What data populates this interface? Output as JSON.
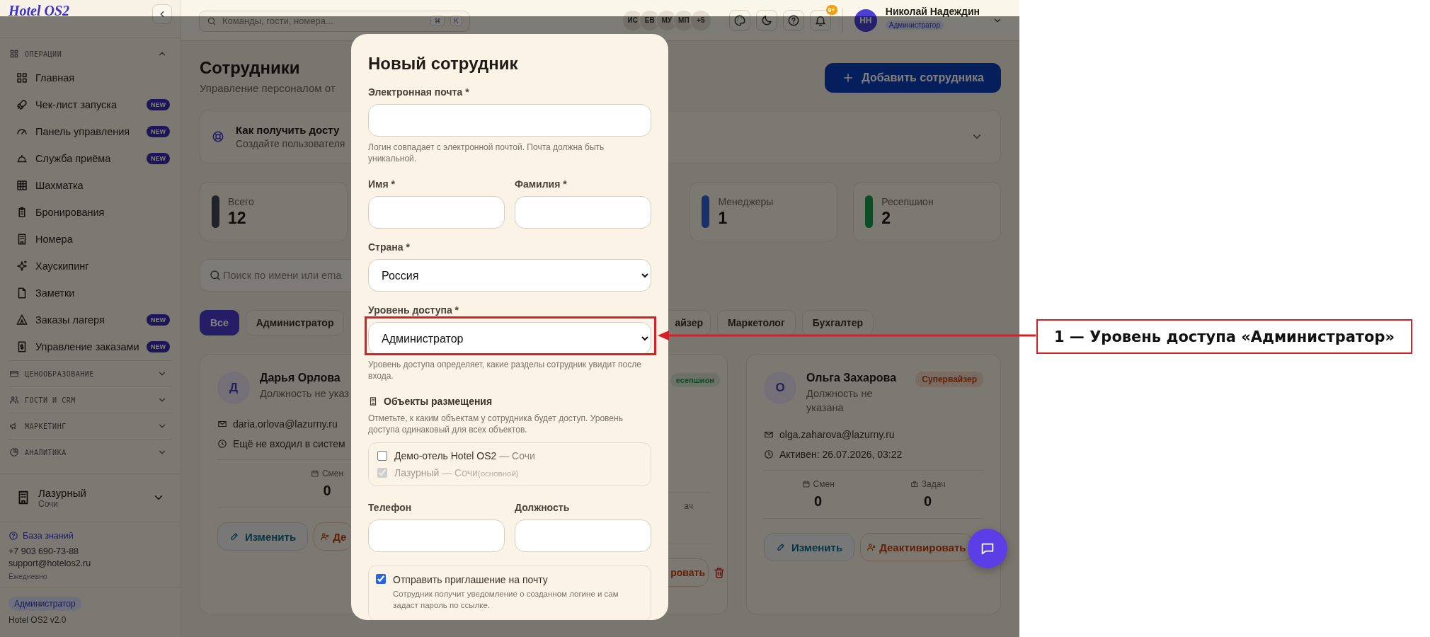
{
  "sidebar": {
    "logo": "Hotel OS2",
    "sections": [
      {
        "title": "ОПЕРАЦИИ",
        "expanded": true,
        "items": [
          {
            "label": "Главная"
          },
          {
            "label": "Чек-лист запуска",
            "badge": "NEW"
          },
          {
            "label": "Панель управления",
            "badge": "NEW"
          },
          {
            "label": "Служба приёма",
            "badge": "NEW"
          },
          {
            "label": "Шахматка"
          },
          {
            "label": "Бронирования"
          },
          {
            "label": "Номера"
          },
          {
            "label": "Хаускипинг"
          },
          {
            "label": "Заметки"
          },
          {
            "label": "Заказы лагеря",
            "badge": "NEW"
          },
          {
            "label": "Управление заказами",
            "badge": "NEW"
          }
        ]
      },
      {
        "title": "ЦЕНООБРАЗОВАНИЕ",
        "expanded": false
      },
      {
        "title": "ГОСТИ И CRM",
        "expanded": false
      },
      {
        "title": "МАРКЕТИНГ",
        "expanded": false
      },
      {
        "title": "АНАЛИТИКА",
        "expanded": false
      }
    ],
    "property": {
      "name": "Лазурный",
      "city": "Сочи"
    },
    "support": {
      "link": "База знаний",
      "phone": "+7 903 690-73-88",
      "email": "support@hotelos2.ru",
      "hours": "Ежедневно"
    },
    "role": "Администратор",
    "version": "Hotel OS2 v2.0"
  },
  "header": {
    "search_placeholder": "Команды, гости, номера...",
    "shortcut": [
      "⌘",
      "K"
    ],
    "online": [
      "ИС",
      "ЕВ",
      "МУ",
      "МП",
      "+5"
    ],
    "notifications": "9+",
    "user": {
      "initials": "НН",
      "name": "Николай Надеждин",
      "role": "Администратор"
    }
  },
  "page": {
    "title": "Сотрудники",
    "subtitle": "Управление персоналом от",
    "add_button": "Добавить сотрудника",
    "help": {
      "title": "Как получить досту",
      "text": "Создайте пользователя",
      "expanded": false
    },
    "stats": [
      {
        "label": "Всего",
        "value": "12",
        "color": "#202329"
      },
      {
        "label": "Менеджеры",
        "value": "1",
        "color": "#18316b"
      },
      {
        "label": "Ресепшион",
        "value": "2",
        "color": "#0b4d24"
      }
    ],
    "search_placeholder": "Поиск по имени или ema",
    "filters": [
      {
        "label": "Все",
        "selected": true
      },
      {
        "label": "Администратор",
        "selected": false
      },
      {
        "label": "айзер",
        "selected": false
      },
      {
        "label": "Маркетолог",
        "selected": false
      },
      {
        "label": "Бухгалтер",
        "selected": false
      }
    ],
    "employees": [
      {
        "kind": "full",
        "initial": "Д",
        "name": "Дарья Орлова",
        "position": "Должность не указ",
        "email": "daria.orlova@lazurny.ru",
        "last_seen": "Ещё не входил в систем",
        "stats": [
          {
            "label": "Смен",
            "value": "0"
          }
        ],
        "edit": "Изменить",
        "deactivate": "Де"
      },
      {
        "kind": "partial",
        "role": {
          "text": "есепшион",
          "kind": "reception"
        },
        "stats": [
          {
            "label": "ач"
          }
        ],
        "deactivate": "ровать",
        "delete_button": true
      },
      {
        "kind": "full",
        "initial": "О",
        "name": "Ольга Захарова",
        "role": {
          "text": "Супервайзер",
          "kind": "supervisor"
        },
        "position": "Должность не указана",
        "email": "olga.zaharova@lazurny.ru",
        "last_seen": "Активен: 26.07.2026, 03:22",
        "stats": [
          {
            "label": "Смен",
            "value": "0"
          },
          {
            "label": "Задач",
            "value": "0"
          }
        ],
        "edit": "Изменить",
        "deactivate": "Деактивировать"
      }
    ]
  },
  "modal": {
    "title": "Новый сотрудник",
    "email": {
      "label": "Электронная почта *",
      "hint": "Логин совпадает с электронной почтой. Почта должна быть уникальной."
    },
    "first_name": {
      "label": "Имя *"
    },
    "last_name": {
      "label": "Фамилия *"
    },
    "country": {
      "label": "Страна *",
      "value": "Россия"
    },
    "access": {
      "label": "Уровень доступа *",
      "value": "Администратор",
      "hint": "Уровень доступа определяет, какие разделы сотрудник увидит после входа."
    },
    "properties": {
      "title": "Объекты размещения",
      "hint": "Отметьте, к каким объектам у сотрудника будет доступ. Уровень доступа одинаковый для всех объектов.",
      "items": [
        {
          "name": "Демо-отель Hotel OS2",
          "location": "— Сочи",
          "checked": false,
          "disabled": false
        },
        {
          "name": "Лазурный",
          "location": "— Сочи",
          "note": "(основной)",
          "checked": true,
          "disabled": true
        }
      ]
    },
    "phone": {
      "label": "Телефон"
    },
    "position": {
      "label": "Должность"
    },
    "invite": {
      "label": "Отправить приглашение на почту",
      "hint": "Сотрудник получит уведомление о созданном логине и сам задаст пароль по ссылке.",
      "checked": true
    }
  },
  "annotation": {
    "label": "1 — Уровень доступа «Администратор»"
  }
}
